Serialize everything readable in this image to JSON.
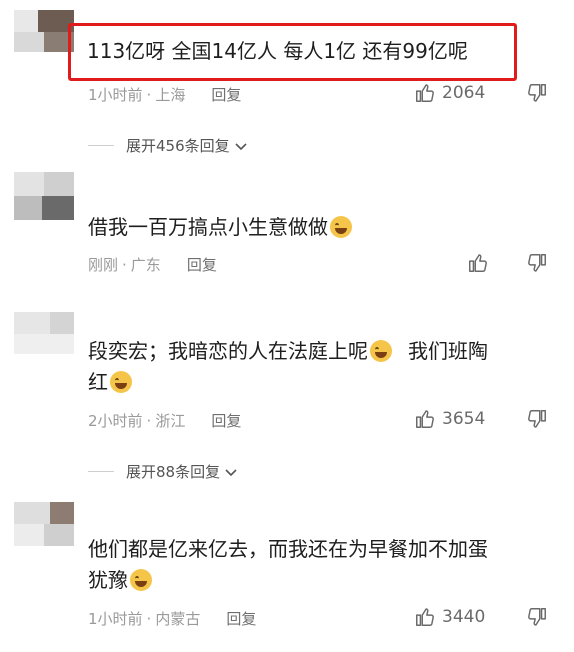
{
  "comments": [
    {
      "text": "113亿呀 全国14亿人 每人1亿 还有99亿呢",
      "time": "1小时前",
      "location": "上海",
      "reply_label": "回复",
      "likes": "2064",
      "expand_label": "展开456条回复"
    },
    {
      "text": "借我一百万搞点小生意做做",
      "time": "刚刚",
      "location": "广东",
      "reply_label": "回复",
      "likes": ""
    },
    {
      "text_line1": "段奕宏；我暗恋的人在法庭上呢",
      "text_line1b": "我们班陶",
      "text_line2": "红",
      "time": "2小时前",
      "location": "浙江",
      "reply_label": "回复",
      "likes": "3654",
      "expand_label": "展开88条回复"
    },
    {
      "text_line1": "他们都是亿来亿去，而我还在为早餐加不加蛋",
      "text_line2": "犹豫",
      "time": "1小时前",
      "location": "内蒙古",
      "reply_label": "回复",
      "likes": "3440"
    }
  ],
  "colors": {
    "highlight": "#e11b1b"
  },
  "icons": [
    "thumbs-up-icon",
    "thumbs-down-icon",
    "chevron-down-icon",
    "crying-emoji-icon",
    "laughing-emoji-icon"
  ]
}
